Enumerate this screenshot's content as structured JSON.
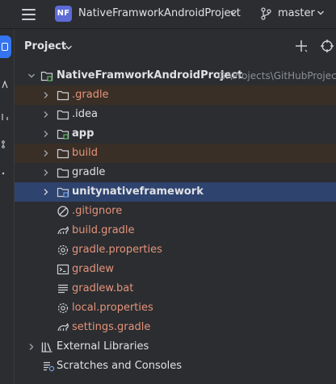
{
  "titlebar": {
    "project_badge": "NF",
    "project_name": "NativeFramworkAndroidProject",
    "branch": "master"
  },
  "panel": {
    "title": "Project"
  },
  "tree": {
    "root": {
      "label": "NativeFramworkAndroidProject",
      "path": "G:\\Projects\\GitHubProject"
    },
    "items": [
      {
        "label": ".gradle"
      },
      {
        "label": ".idea"
      },
      {
        "label": "app"
      },
      {
        "label": "build"
      },
      {
        "label": "gradle"
      },
      {
        "label": "unitynativeframework"
      },
      {
        "label": ".gitignore"
      },
      {
        "label": "build.gradle"
      },
      {
        "label": "gradle.properties"
      },
      {
        "label": "gradlew"
      },
      {
        "label": "gradlew.bat"
      },
      {
        "label": "local.properties"
      },
      {
        "label": "settings.gradle"
      }
    ],
    "external_libraries": "External Libraries",
    "scratches": "Scratches and Consoles"
  },
  "colors": {
    "accent": "#3574f0",
    "ignored_row": "#3a2f26",
    "selected_row": "#2e436e",
    "ignored_text": "#e5937b"
  }
}
